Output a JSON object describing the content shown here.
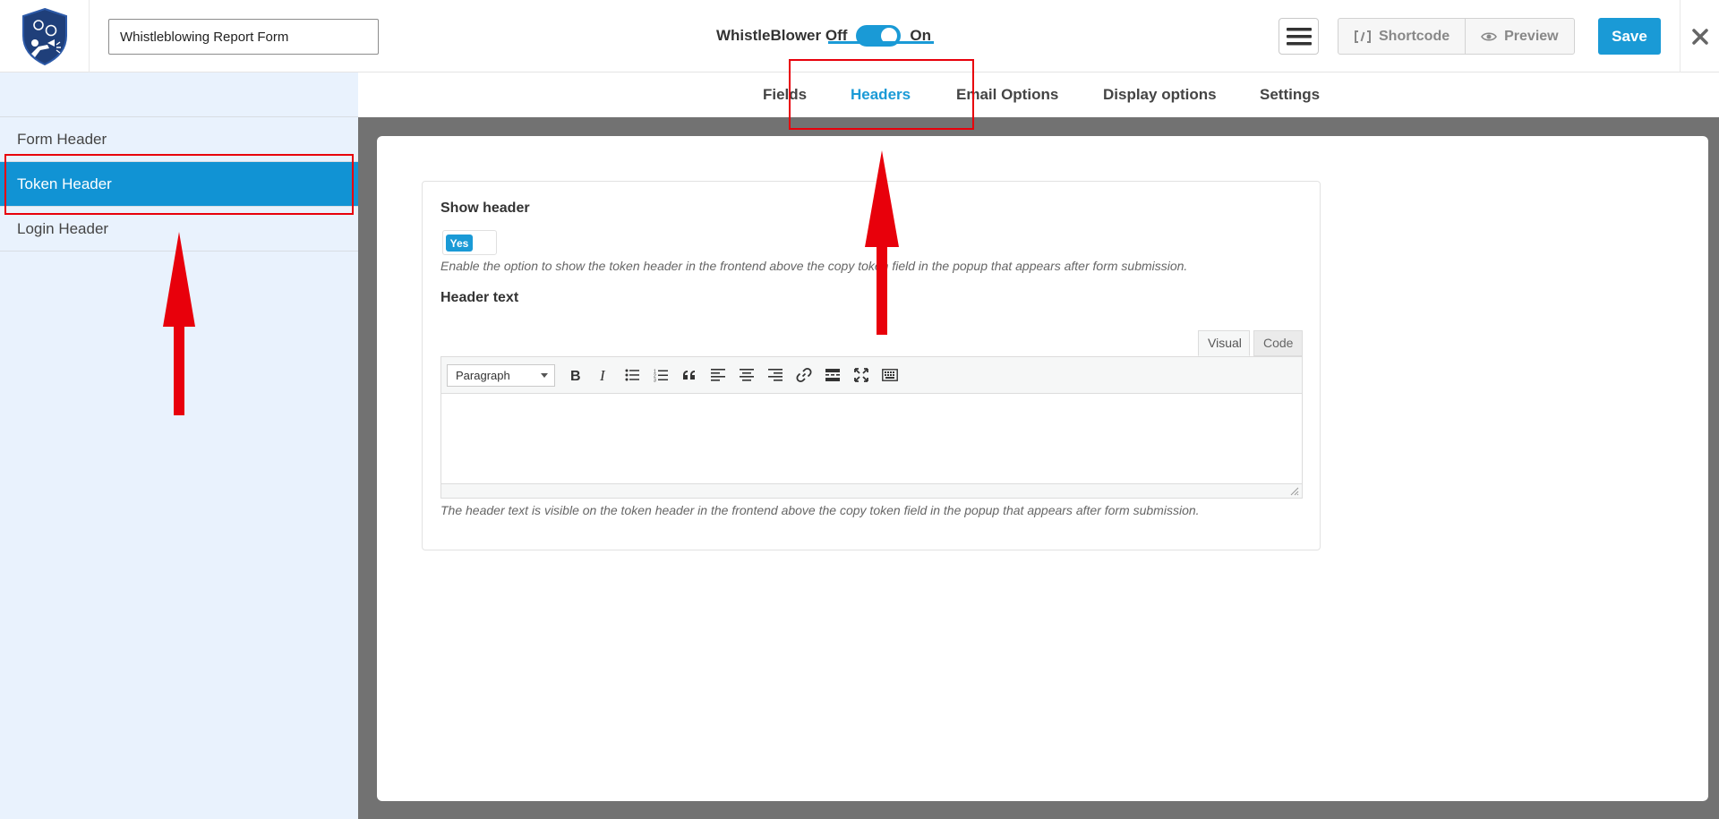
{
  "header": {
    "form_title": "Whistleblowing Report Form",
    "toggle_off_label": "WhistleBlower Off",
    "toggle_on_label": "On",
    "shortcode_label": "Shortcode",
    "preview_label": "Preview",
    "save_label": "Save"
  },
  "tabs": [
    "Fields",
    "Headers",
    "Email Options",
    "Display options",
    "Settings"
  ],
  "active_tab": "Headers",
  "sidebar": {
    "items": [
      "Form Header",
      "Token Header",
      "Login Header"
    ],
    "active": "Token Header"
  },
  "form": {
    "show_header_label": "Show header",
    "show_header_value": "Yes",
    "show_header_help": "Enable the option to show the token header in the frontend above the copy token field in the popup that appears after form submission.",
    "header_text_label": "Header text",
    "editor_tab_visual": "Visual",
    "editor_tab_code": "Code",
    "format_select": "Paragraph",
    "header_text_help": "The header text is visible on the token header in the frontend above the copy token field in the popup that appears after form submission."
  },
  "colors": {
    "accent": "#1a9ad6",
    "sidebar_active": "#1193d4",
    "annotation_red": "#e8000b"
  }
}
